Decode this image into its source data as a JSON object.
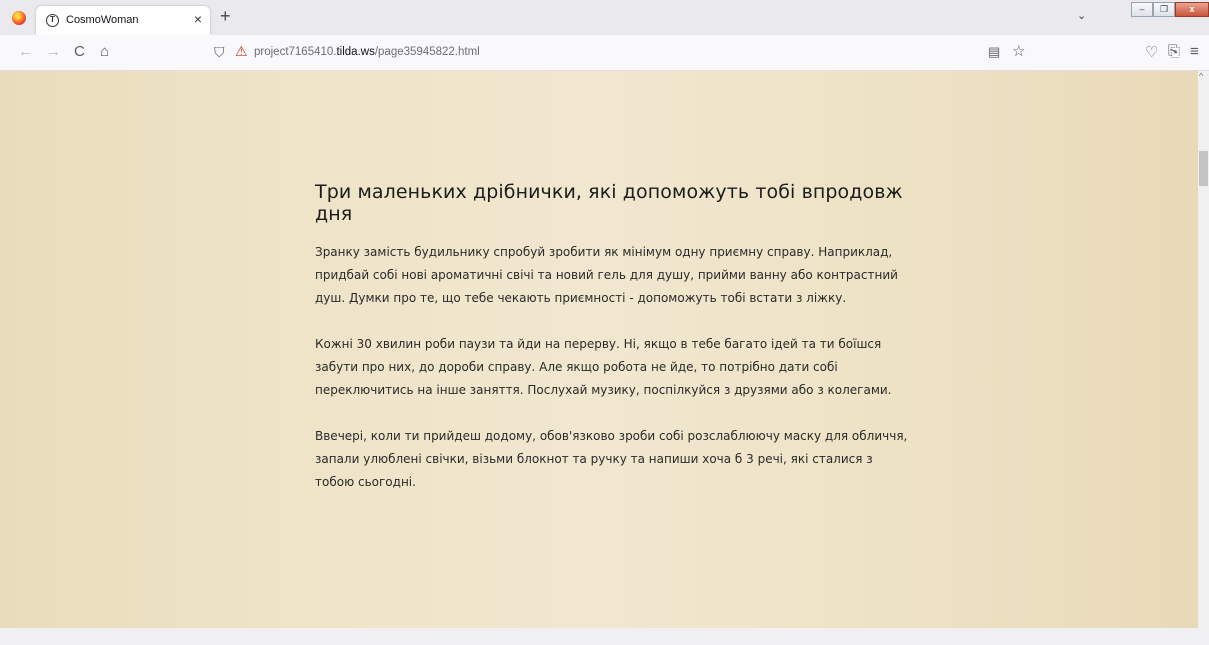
{
  "browser": {
    "tab": {
      "title": "CosmoWoman",
      "close": "×",
      "favicon_glyph": "T"
    },
    "new_tab": "+",
    "tab_list": "⌄",
    "window_controls": {
      "minimize": "–",
      "maximize": "❐",
      "close": "x"
    },
    "nav": {
      "back": "←",
      "forward": "→",
      "reload": "C",
      "home": "⌂"
    },
    "url": {
      "prefix": "project7165410.",
      "host": "tilda.ws",
      "path": "/page35945822.html"
    },
    "icons": {
      "reader": "reader-view-icon",
      "bookmark": "star-icon",
      "pocket": "pocket-icon",
      "extensions": "extensions-icon",
      "menu": "hamburger-menu-icon"
    }
  },
  "article": {
    "title": "Три маленьких дрібнички, які допоможуть тобі впродовж дня",
    "paragraphs": [
      "Зранку замість будильнику спробуй зробити як мінімум одну приємну справу. Наприклад, придбай собі нові ароматичні свічі та новий гель для душу, прийми ванну або контрастний душ. Думки про те, що тебе чекають приємності - допоможуть тобі встати з ліжку.",
      "Кожні 30 хвилин роби паузи та йди на перерву. Ні, якщо в тебе багато ідей та ти боїшся забути про них, до дороби справу. Але якщо робота не йде, то потрібно дати собі переключитись на інше заняття. Послухай музику, поспілкуйся з друзями або з колегами.",
      "Ввечері, коли ти прийдеш додому, обов'язково зроби собі розслаблюючу маску для обличчя, запали улюблені свічки, візьми блокнот та ручку та напиши хоча б 3 речі, які сталися з тобою сьогодні."
    ]
  },
  "colors": {
    "page_bg": "#efe4c8",
    "text": "#2a2a2a",
    "browser_chrome": "#f9f9fb"
  }
}
